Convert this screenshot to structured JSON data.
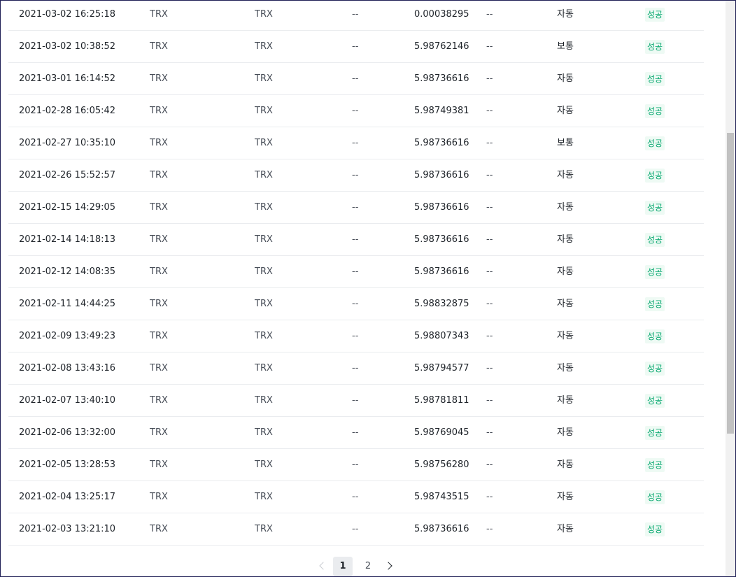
{
  "rows": [
    {
      "time": "2021-03-02 16:25:18",
      "coin": "TRX",
      "network": "TRX",
      "address": "--",
      "amount": "0.00038295",
      "txid": "--",
      "type": "자동",
      "status": "성공"
    },
    {
      "time": "2021-03-02 10:38:52",
      "coin": "TRX",
      "network": "TRX",
      "address": "--",
      "amount": "5.98762146",
      "txid": "--",
      "type": "보통",
      "status": "성공"
    },
    {
      "time": "2021-03-01 16:14:52",
      "coin": "TRX",
      "network": "TRX",
      "address": "--",
      "amount": "5.98736616",
      "txid": "--",
      "type": "자동",
      "status": "성공"
    },
    {
      "time": "2021-02-28 16:05:42",
      "coin": "TRX",
      "network": "TRX",
      "address": "--",
      "amount": "5.98749381",
      "txid": "--",
      "type": "자동",
      "status": "성공"
    },
    {
      "time": "2021-02-27 10:35:10",
      "coin": "TRX",
      "network": "TRX",
      "address": "--",
      "amount": "5.98736616",
      "txid": "--",
      "type": "보통",
      "status": "성공"
    },
    {
      "time": "2021-02-26 15:52:57",
      "coin": "TRX",
      "network": "TRX",
      "address": "--",
      "amount": "5.98736616",
      "txid": "--",
      "type": "자동",
      "status": "성공"
    },
    {
      "time": "2021-02-15 14:29:05",
      "coin": "TRX",
      "network": "TRX",
      "address": "--",
      "amount": "5.98736616",
      "txid": "--",
      "type": "자동",
      "status": "성공"
    },
    {
      "time": "2021-02-14 14:18:13",
      "coin": "TRX",
      "network": "TRX",
      "address": "--",
      "amount": "5.98736616",
      "txid": "--",
      "type": "자동",
      "status": "성공"
    },
    {
      "time": "2021-02-12 14:08:35",
      "coin": "TRX",
      "network": "TRX",
      "address": "--",
      "amount": "5.98736616",
      "txid": "--",
      "type": "자동",
      "status": "성공"
    },
    {
      "time": "2021-02-11 14:44:25",
      "coin": "TRX",
      "network": "TRX",
      "address": "--",
      "amount": "5.98832875",
      "txid": "--",
      "type": "자동",
      "status": "성공"
    },
    {
      "time": "2021-02-09 13:49:23",
      "coin": "TRX",
      "network": "TRX",
      "address": "--",
      "amount": "5.98807343",
      "txid": "--",
      "type": "자동",
      "status": "성공"
    },
    {
      "time": "2021-02-08 13:43:16",
      "coin": "TRX",
      "network": "TRX",
      "address": "--",
      "amount": "5.98794577",
      "txid": "--",
      "type": "자동",
      "status": "성공"
    },
    {
      "time": "2021-02-07 13:40:10",
      "coin": "TRX",
      "network": "TRX",
      "address": "--",
      "amount": "5.98781811",
      "txid": "--",
      "type": "자동",
      "status": "성공"
    },
    {
      "time": "2021-02-06 13:32:00",
      "coin": "TRX",
      "network": "TRX",
      "address": "--",
      "amount": "5.98769045",
      "txid": "--",
      "type": "자동",
      "status": "성공"
    },
    {
      "time": "2021-02-05 13:28:53",
      "coin": "TRX",
      "network": "TRX",
      "address": "--",
      "amount": "5.98756280",
      "txid": "--",
      "type": "자동",
      "status": "성공"
    },
    {
      "time": "2021-02-04 13:25:17",
      "coin": "TRX",
      "network": "TRX",
      "address": "--",
      "amount": "5.98743515",
      "txid": "--",
      "type": "자동",
      "status": "성공"
    },
    {
      "time": "2021-02-03 13:21:10",
      "coin": "TRX",
      "network": "TRX",
      "address": "--",
      "amount": "5.98736616",
      "txid": "--",
      "type": "자동",
      "status": "성공"
    }
  ],
  "pagination": {
    "prev_icon": "chevron-left-icon",
    "pages": [
      "1",
      "2"
    ],
    "current_page": "1",
    "next_icon": "chevron-right-icon"
  },
  "colors": {
    "status_success": "#03a66d",
    "status_success_bg": "#eefaf4",
    "border": "#1f1f55"
  }
}
